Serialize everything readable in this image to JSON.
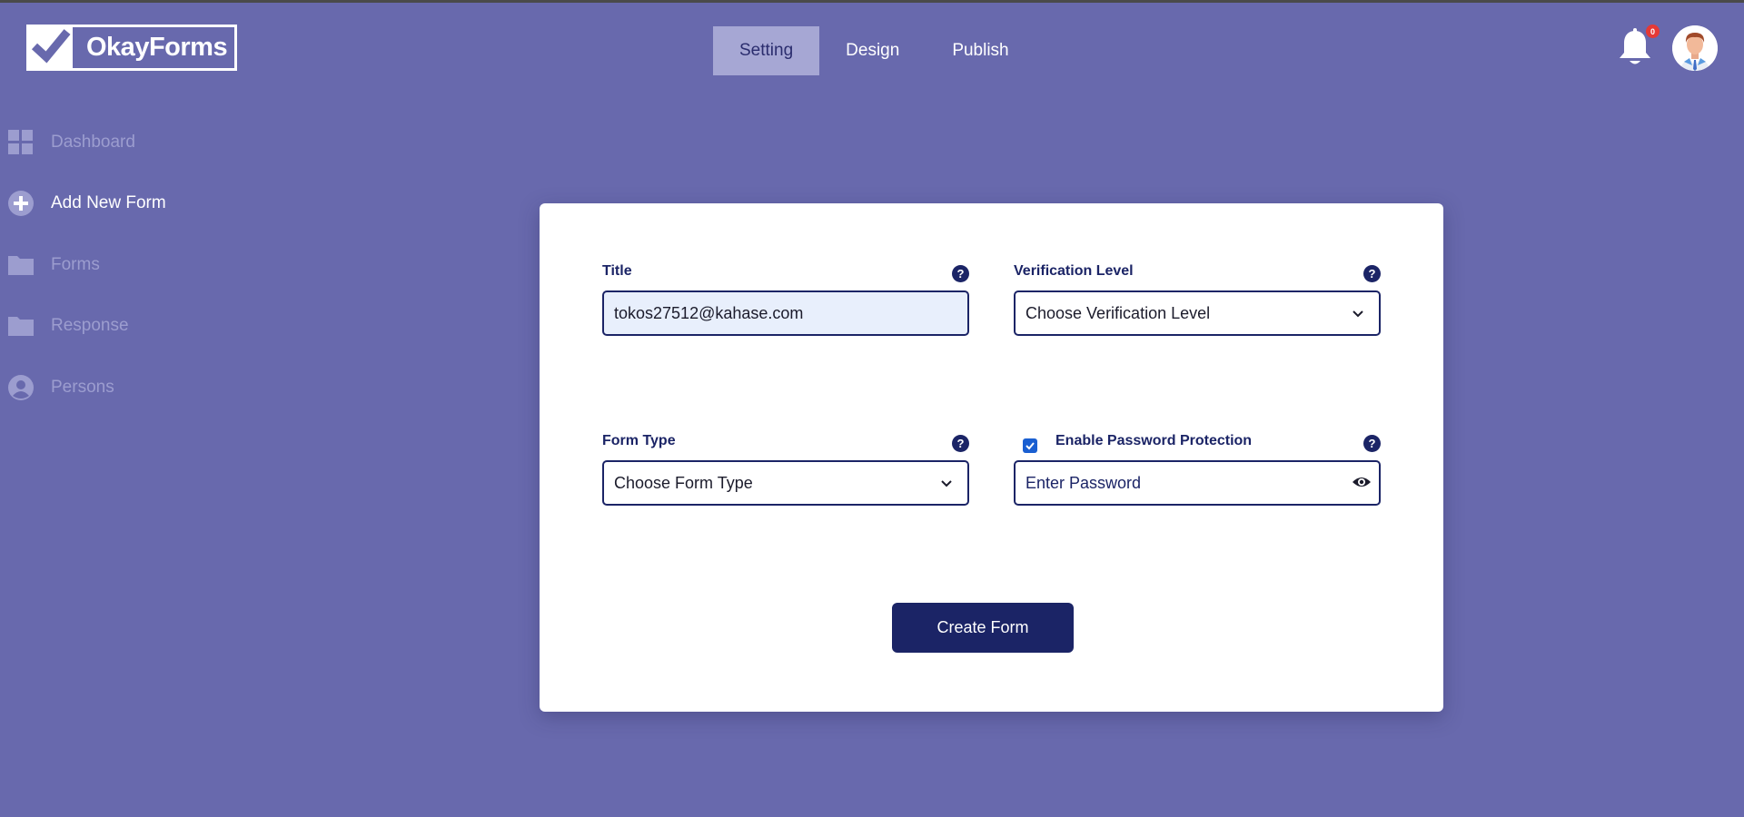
{
  "brand": {
    "logo_text": "OkayForms"
  },
  "nav": {
    "tabs": [
      {
        "label": "Setting",
        "active": true
      },
      {
        "label": "Design",
        "active": false
      },
      {
        "label": "Publish",
        "active": false
      }
    ]
  },
  "header": {
    "notification_count": "0",
    "bell_icon": "bell-icon",
    "avatar_icon": "user-avatar"
  },
  "sidebar": {
    "items": [
      {
        "label": "Dashboard",
        "icon": "grid-icon",
        "active": false
      },
      {
        "label": "Add New Form",
        "icon": "plus-circle-icon",
        "active": true
      },
      {
        "label": "Forms",
        "icon": "folder-icon",
        "active": false
      },
      {
        "label": "Response",
        "icon": "folder-icon",
        "active": false
      },
      {
        "label": "Persons",
        "icon": "person-circle-icon",
        "active": false
      }
    ]
  },
  "form": {
    "title": {
      "label": "Title",
      "value": "tokos27512@kahase.com"
    },
    "verification": {
      "label": "Verification Level",
      "selected": "Choose Verification Level"
    },
    "form_type": {
      "label": "Form Type",
      "selected": "Choose Form Type"
    },
    "password": {
      "label": "Enable Password Protection",
      "checked": true,
      "placeholder": "Enter Password"
    },
    "help_glyph": "?",
    "submit_label": "Create Form"
  },
  "colors": {
    "background": "#6869ad",
    "accent": "#1b2466",
    "active_tab": "#a6a7d4",
    "badge": "#e53935",
    "checkbox": "#1a5fd1"
  }
}
